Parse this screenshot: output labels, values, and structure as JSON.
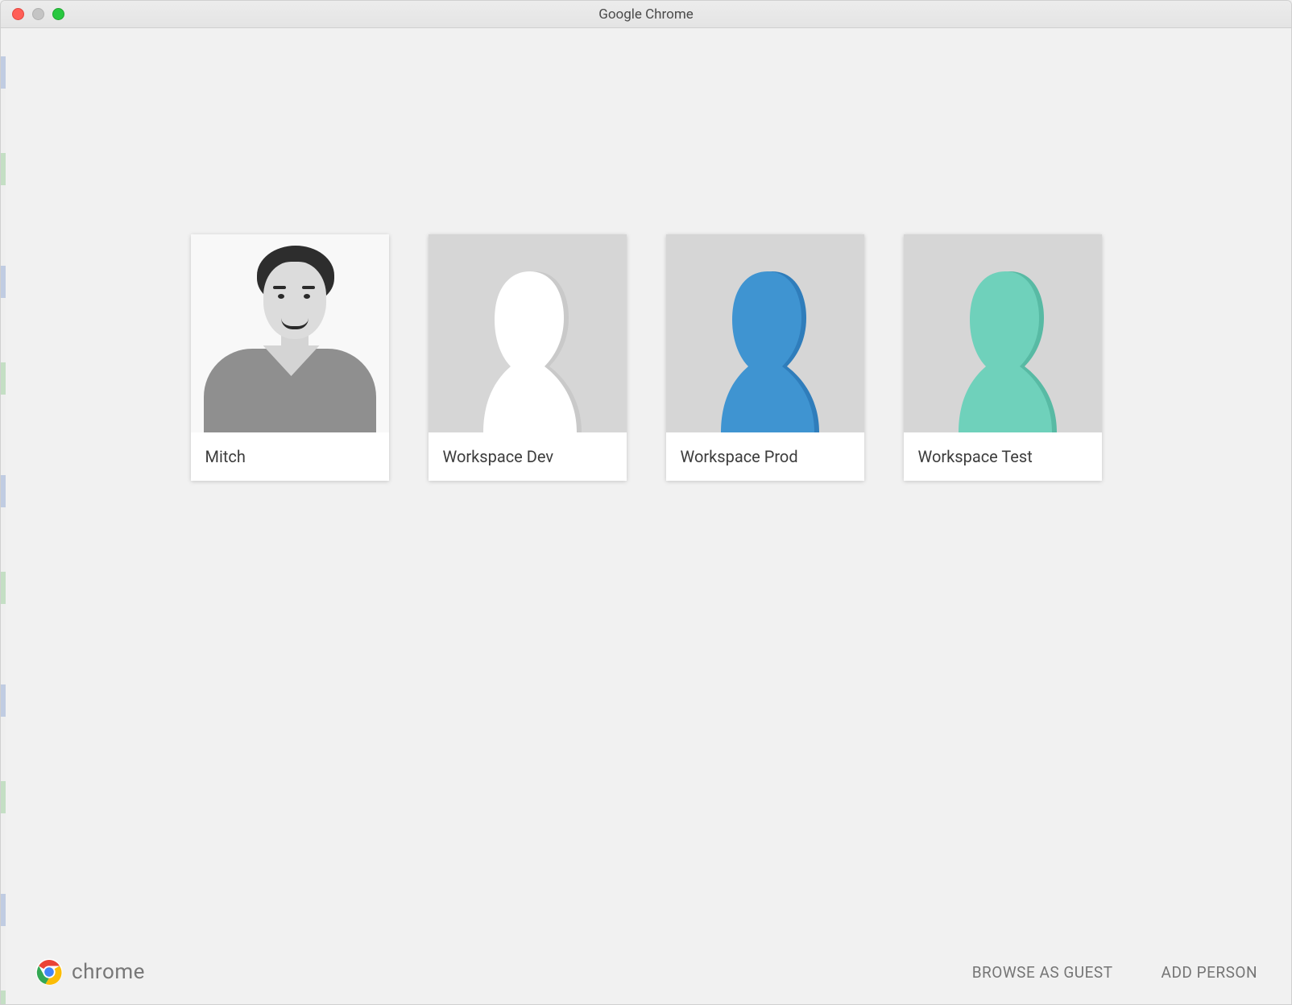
{
  "window": {
    "title": "Google Chrome"
  },
  "profiles": [
    {
      "name": "Mitch",
      "avatar_type": "photo",
      "avatar_color": "#9a9a9a"
    },
    {
      "name": "Workspace Dev",
      "avatar_type": "generic",
      "avatar_color": "#ffffff",
      "avatar_shadow": "#c9c9c9"
    },
    {
      "name": "Workspace Prod",
      "avatar_type": "generic",
      "avatar_color": "#3f94d1",
      "avatar_shadow": "#2f7dbb"
    },
    {
      "name": "Workspace Test",
      "avatar_type": "generic",
      "avatar_color": "#6fd1bb",
      "avatar_shadow": "#58baa4"
    }
  ],
  "footer": {
    "brand": "chrome",
    "browse_guest_label": "BROWSE AS GUEST",
    "add_person_label": "ADD PERSON"
  },
  "colors": {
    "card_bg": "#ffffff",
    "page_bg": "#f1f1f1",
    "avatar_bg": "#d6d6d6"
  }
}
